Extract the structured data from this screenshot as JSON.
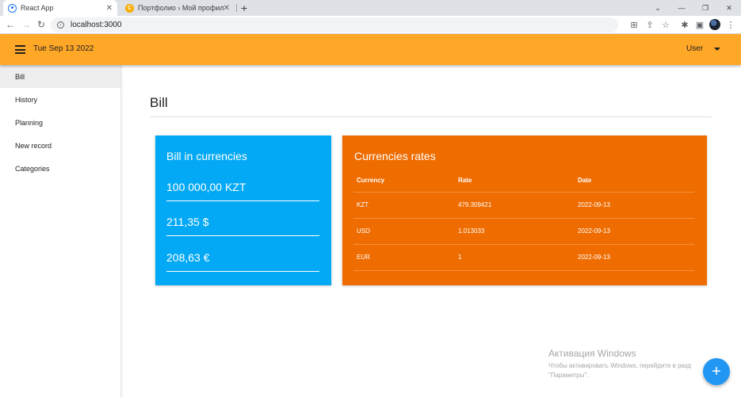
{
  "browser": {
    "tabs": [
      {
        "title": "React App",
        "icon": "react-icon"
      },
      {
        "title": "Портфолио › Мой профиль",
        "icon": "site-icon"
      }
    ],
    "url": "localhost:3000"
  },
  "header": {
    "date": "Tue Sep 13 2022",
    "user": "User"
  },
  "sidebar": {
    "items": [
      {
        "label": "Bill",
        "active": true
      },
      {
        "label": "History"
      },
      {
        "label": "Planning"
      },
      {
        "label": "New record"
      },
      {
        "label": "Categories"
      }
    ]
  },
  "main": {
    "title": "Bill",
    "bill_card": {
      "title": "Bill in currencies",
      "amounts": [
        "100 000,00 KZT",
        "211,35 $",
        "208,63 €"
      ],
      "color": "#03a9f4"
    },
    "rates_card": {
      "title": "Currencies rates",
      "columns": [
        "Currency",
        "Rate",
        "Date"
      ],
      "rows": [
        [
          "KZT",
          "479.309421",
          "2022-09-13"
        ],
        [
          "USD",
          "1.013033",
          "2022-09-13"
        ],
        [
          "EUR",
          "1",
          "2022-09-13"
        ]
      ],
      "color": "#ef6c00"
    }
  },
  "watermark": {
    "title": "Активация Windows",
    "line1": "Чтобы активировать Windows, перейдите в разд",
    "line2": "\"Параметры\"."
  },
  "fab": {
    "label": "+"
  },
  "colors": {
    "appbar": "#ffa726",
    "fab": "#2196f3"
  }
}
